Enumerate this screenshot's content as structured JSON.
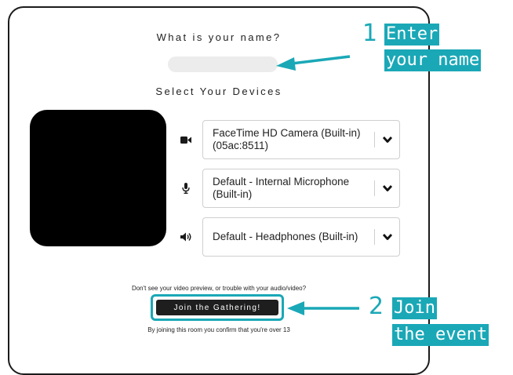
{
  "form": {
    "name_heading": "What is your name?",
    "name_value": "",
    "devices_heading": "Select Your Devices",
    "camera_select": "FaceTime HD Camera (Built-in) (05ac:8511)",
    "microphone_select": "Default - Internal Microphone (Built-in)",
    "speaker_select": "Default - Headphones (Built-in)",
    "trouble_note": "Don't see your video preview, or trouble with your audio/video?",
    "join_label": "Join the Gathering!",
    "age_note": "By joining this room you confirm that you're over 13"
  },
  "icons": {
    "camera": "video-camera-icon",
    "microphone": "microphone-icon",
    "speaker": "speaker-icon",
    "chevron": "chevron-down-icon"
  },
  "annotations": {
    "step1_number": "1",
    "step1_line1": "Enter",
    "step1_line2": "your name",
    "step2_number": "2",
    "step2_line1": "Join",
    "step2_line2": "the event"
  },
  "colors": {
    "annotation_accent": "#1aa8b7",
    "button_bg": "#1e1e1e",
    "input_bg": "#ececec"
  }
}
